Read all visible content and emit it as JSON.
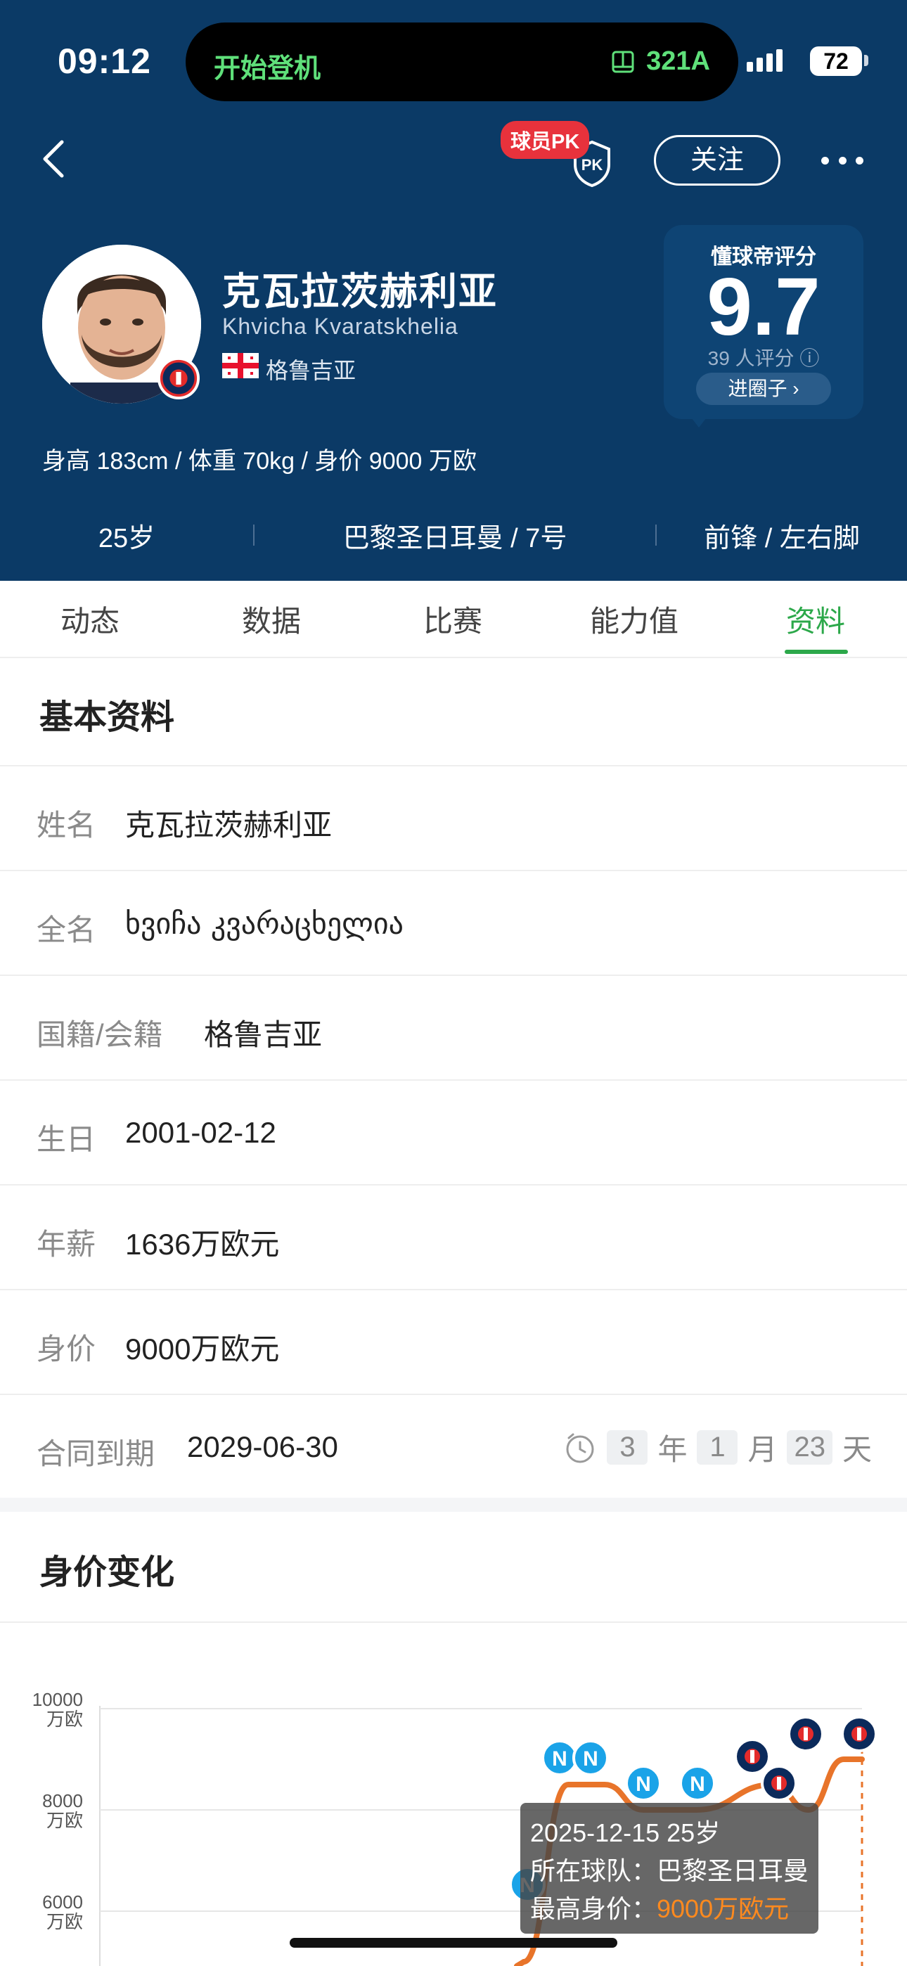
{
  "status_bar": {
    "time": "09:12",
    "activity": "开始登机",
    "gate": "321A",
    "battery": "72"
  },
  "nav": {
    "pk_badge": "球员PK",
    "pk_shield": "PK",
    "follow": "关注"
  },
  "player": {
    "name_cn": "克瓦拉茨赫利亚",
    "name_en": "Khvicha Kvaratskhelia",
    "nation": "格鲁吉亚",
    "body_stats": "身高 183cm / 体重 70kg / 身价 9000 万欧",
    "age": "25岁",
    "team_number": "巴黎圣日耳曼 / 7号",
    "position_foot": "前锋 / 左右脚"
  },
  "rating": {
    "label": "懂球帝评分",
    "score": "9.7",
    "count": "39 人评分",
    "button": "进圈子"
  },
  "tabs": [
    {
      "label": "动态"
    },
    {
      "label": "数据"
    },
    {
      "label": "比赛"
    },
    {
      "label": "能力值"
    },
    {
      "label": "资料"
    }
  ],
  "basic_info": {
    "title": "基本资料",
    "rows": [
      {
        "label": "姓名",
        "value": "克瓦拉茨赫利亚"
      },
      {
        "label": "全名",
        "value": "ხვიჩა კვარაცხელია"
      },
      {
        "label": "国籍/会籍",
        "value": "格鲁吉亚"
      },
      {
        "label": "生日",
        "value": "2001-02-12"
      },
      {
        "label": "年薪",
        "value": "1636万欧元"
      },
      {
        "label": "身价",
        "value": "9000万欧元"
      },
      {
        "label": "合同到期",
        "value": "2029-06-30"
      }
    ],
    "countdown": {
      "years": "3",
      "year_unit": "年",
      "months": "1",
      "month_unit": "月",
      "days": "23",
      "day_unit": "天"
    }
  },
  "value_section": {
    "title": "身价变化"
  },
  "chart_data": {
    "type": "line",
    "yticks": [
      {
        "value": 10000,
        "label": "10000",
        "unit": "万欧"
      },
      {
        "value": 8000,
        "label": "8000",
        "unit": "万欧"
      },
      {
        "value": 6000,
        "label": "6000",
        "unit": "万欧"
      }
    ],
    "series": [
      {
        "values": [
          5000,
          8500,
          8500,
          8000,
          8000,
          8500,
          8000,
          9000,
          9000
        ]
      }
    ],
    "markers": [
      "napoli",
      "napoli",
      "napoli",
      "napoli",
      "napoli",
      "psg",
      "psg",
      "psg",
      "psg"
    ],
    "line_color": "#e8742a",
    "tooltip": {
      "date_age": "2025-12-15 25岁",
      "team": "所在球队：巴黎圣日耳曼",
      "max_label": "最高身价：",
      "max_value": "9000万欧元"
    }
  }
}
